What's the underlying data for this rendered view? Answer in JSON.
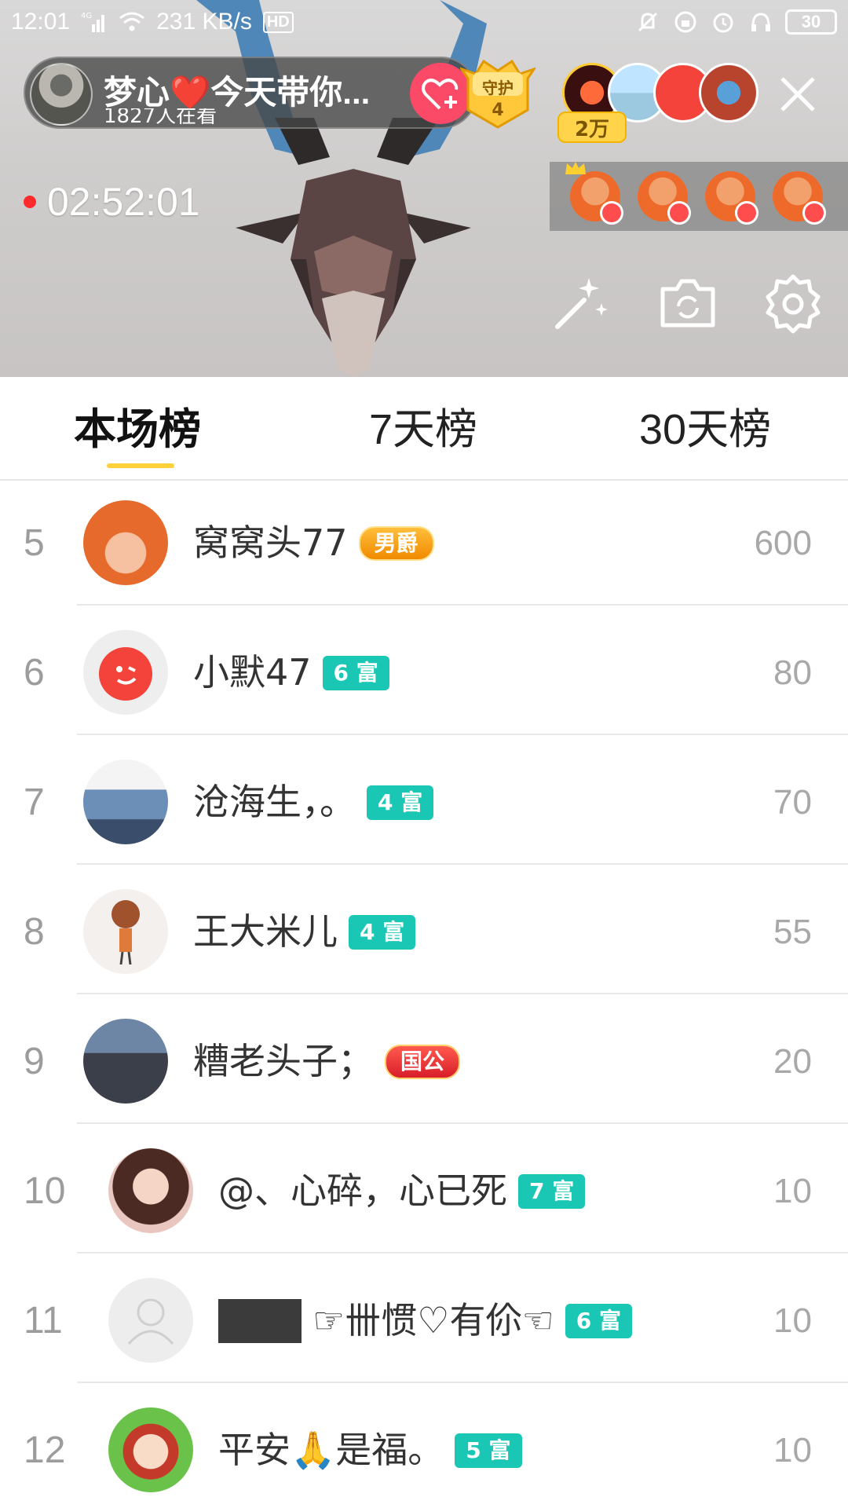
{
  "status_bar": {
    "time": "12:01",
    "network": "4G",
    "speed": "231 KB/s",
    "hd": "HD",
    "battery": "30"
  },
  "live": {
    "host_name": "梦心❤️今天带你...",
    "host_sub": "1827人在看",
    "guard_label": "守护",
    "guard_count": "4",
    "viewer_count": "2万",
    "timer": "02:52:01"
  },
  "tabs": [
    {
      "label": "本场榜",
      "active": true
    },
    {
      "label": "7天榜",
      "active": false
    },
    {
      "label": "30天榜",
      "active": false
    }
  ],
  "ranking": [
    {
      "rank": "5",
      "name": "窝窝头77",
      "badge": "男爵",
      "badge_type": "noble",
      "score": "600"
    },
    {
      "rank": "6",
      "name": "小默47",
      "badge": "6 富",
      "badge_type": "rich",
      "score": "80"
    },
    {
      "rank": "7",
      "name": "沧海生，。",
      "badge": "4 富",
      "badge_type": "rich",
      "score": "70"
    },
    {
      "rank": "8",
      "name": "王大米儿",
      "badge": "4 富",
      "badge_type": "rich",
      "score": "55"
    },
    {
      "rank": "9",
      "name": "糟老头子；",
      "badge": "国公",
      "badge_type": "duke",
      "score": "20"
    },
    {
      "rank": "10",
      "name": "@、心碎，心已死",
      "badge": "7 富",
      "badge_type": "rich",
      "score": "10"
    },
    {
      "rank": "11",
      "name": "☞卌惯♡有伱☜",
      "badge": "6 富",
      "badge_type": "rich",
      "score": "10"
    },
    {
      "rank": "12",
      "name": "平安🙏是福。",
      "badge": "5 富",
      "badge_type": "rich",
      "score": "10"
    }
  ],
  "icons": {
    "follow": "heart-plus-icon",
    "close": "close-icon",
    "magic": "magic-wand-icon",
    "camera_switch": "camera-switch-icon",
    "settings": "gear-icon"
  },
  "colors": {
    "accent_underline": "#ffd23c",
    "rich_badge": "#19c7b4",
    "follow_button": "#fa4a67",
    "live_dot": "#ff2a2a"
  }
}
